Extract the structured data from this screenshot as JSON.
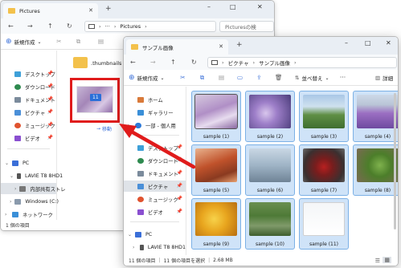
{
  "back_window": {
    "tab_title": "Pictures",
    "breadcrumb": "Pictures",
    "search_placeholder": "Picturesの検",
    "new_button": "新規作成",
    "folder_name": ".thumbnails",
    "drag_badge": "11",
    "drag_label": "移動",
    "sidebar": {
      "quick": [
        "デスクトップ",
        "ダウンロード",
        "ドキュメント",
        "ピクチャ",
        "ミュージック",
        "ビデオ"
      ],
      "pc": "PC",
      "drive": "LAVIE T8 8HD1",
      "internal": "内部共有ストレ",
      "windows": "Windows (C:)",
      "network": "ネットワーク"
    },
    "status": "1 個の項目"
  },
  "front_window": {
    "tab_title": "サンプル画像",
    "breadcrumb_parent": "ピクチャ",
    "breadcrumb_current": "サンプル画像",
    "new_button": "新規作成",
    "sort_button": "並べ替え",
    "details_button": "詳細",
    "sidebar": {
      "home": "ホーム",
      "gallery": "ギャラリー",
      "onedrive": "一部 - 個人用",
      "quick": [
        "デスクトップ",
        "ダウンロード",
        "ドキュメント",
        "ピクチャ",
        "ミュージック",
        "ビデオ"
      ],
      "pc": "PC",
      "drive": "LAVIE T8 8HD1"
    },
    "files": [
      "sample (1)",
      "sample (2)",
      "sample (3)",
      "sample (4)",
      "sample (5)",
      "sample (6)",
      "sample (7)",
      "sample (8)",
      "sample (9)",
      "sample (10)",
      "sample (11)"
    ],
    "status_count": "11 個の項目",
    "status_selected": "11 個の項目を選択",
    "status_size": "2.68 MB"
  },
  "colors": {
    "highlight": "#e01b1b",
    "selection": "#cfe3f8",
    "selection_border": "#7cb1e6",
    "accent": "#3a6fd8"
  }
}
